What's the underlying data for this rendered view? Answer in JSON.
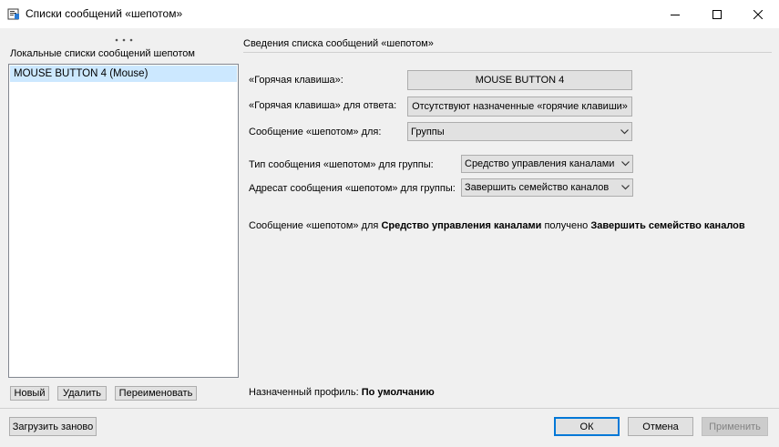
{
  "window": {
    "title": "Списки сообщений «шепотом»"
  },
  "left_panel": {
    "label": "Локальные списки сообщений шепотом",
    "items": [
      {
        "label": "MOUSE BUTTON 4 (Mouse)",
        "selected": true
      }
    ],
    "buttons": {
      "new": "Новый",
      "delete": "Удалить",
      "rename": "Переименовать"
    }
  },
  "details": {
    "header": "Сведения списка сообщений «шепотом»",
    "hotkey_label": "«Горячая клавиша»:",
    "hotkey_value": "MOUSE BUTTON 4",
    "reply_hotkey_label": "«Горячая клавиша» для ответа:",
    "reply_hotkey_value": "Отсутствуют назначенные «горячие клавиши»",
    "whisper_for_label": "Сообщение «шепотом» для:",
    "whisper_for_value": "Группы",
    "group_type_label": "Тип сообщения «шепотом» для группы:",
    "group_type_value": "Средство управления каналами",
    "group_target_label": "Адресат сообщения «шепотом» для группы:",
    "group_target_value": "Завершить семейство каналов",
    "summary": {
      "prefix": "Сообщение «шепотом» для",
      "type": "Средство управления каналами",
      "middle": "получено",
      "target": "Завершить семейство каналов"
    },
    "profile_label": "Назначенный профиль:",
    "profile_value": "По умолчанию"
  },
  "footer": {
    "reload": "Загрузить заново",
    "ok": "ОК",
    "cancel": "Отмена",
    "apply": "Применить"
  },
  "colors": {
    "selection": "#cce8ff",
    "default_button_border": "#0078d7"
  }
}
